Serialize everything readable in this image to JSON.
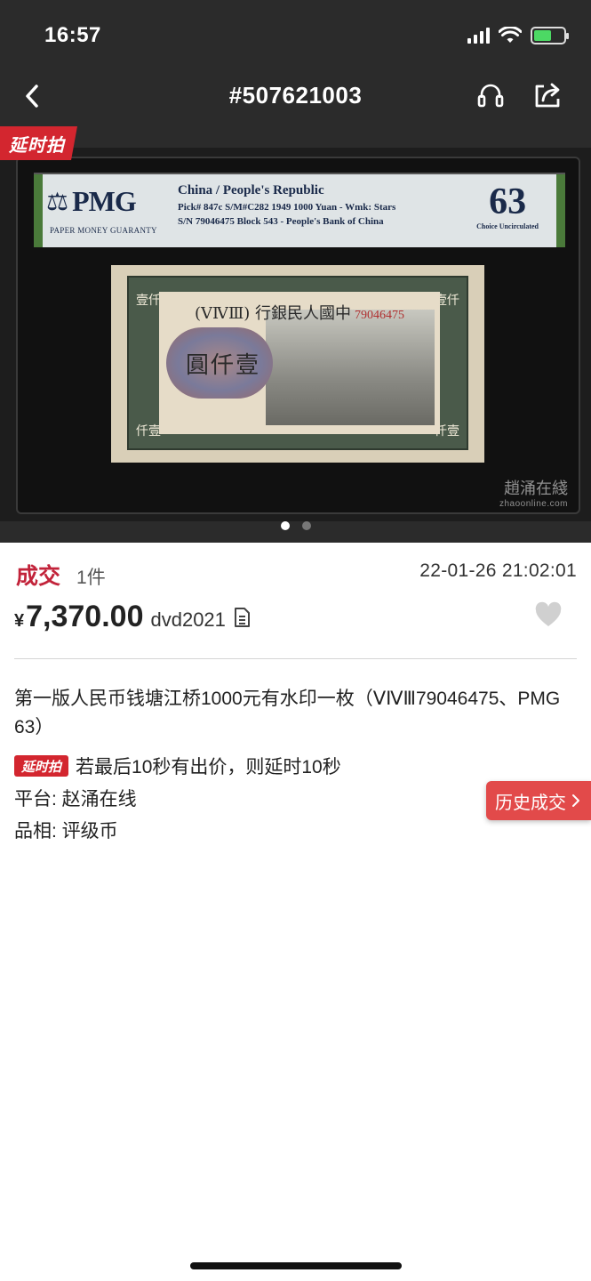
{
  "status_bar": {
    "time": "16:57"
  },
  "nav": {
    "title": "#507621003"
  },
  "carousel": {
    "tag": "延时拍",
    "watermark": "趙涌在綫",
    "watermark_sub": "zhaoonline.com",
    "slide_count": 2,
    "active_slide": 1,
    "label": {
      "logo": "PMG",
      "logo_sub": "PAPER MONEY GUARANTY",
      "line1": "China / People's Republic",
      "line2": "Pick# 847c  S/M#C282   1949  1000 Yuan - Wmk: Stars",
      "line3": "S/N 79046475 Block 543 - People's Bank of China",
      "grade": "63",
      "grade_desc": "Choice Uncirculated"
    },
    "note": {
      "header": "(ⅤⅣⅢ) 行銀民人國中",
      "serial": "79046475",
      "center_text": "圓仟壹",
      "corner_tl": "壹仟",
      "corner_tr": "壹仟",
      "corner_bl": "仟壹",
      "corner_br": "仟壹"
    }
  },
  "deal": {
    "status": "成交",
    "qty": "1件",
    "time": "22-01-26 21:02:01",
    "currency": "¥",
    "price": "7,370.00",
    "seller": "dvd2021"
  },
  "item": {
    "title": "第一版人民币钱塘江桥1000元有水印一枚（ⅤⅣⅢ79046475、PMG 63）",
    "timed_badge": "延时拍",
    "timed_text": "若最后10秒有出价，则延时10秒",
    "platform": "平台: 赵涌在线",
    "grade": "品相: 评级币",
    "history_button": "历史成交"
  },
  "colors": {
    "accent": "#c2233a",
    "tag_red": "#d3262f",
    "dark_bg": "#2b2b2b"
  }
}
